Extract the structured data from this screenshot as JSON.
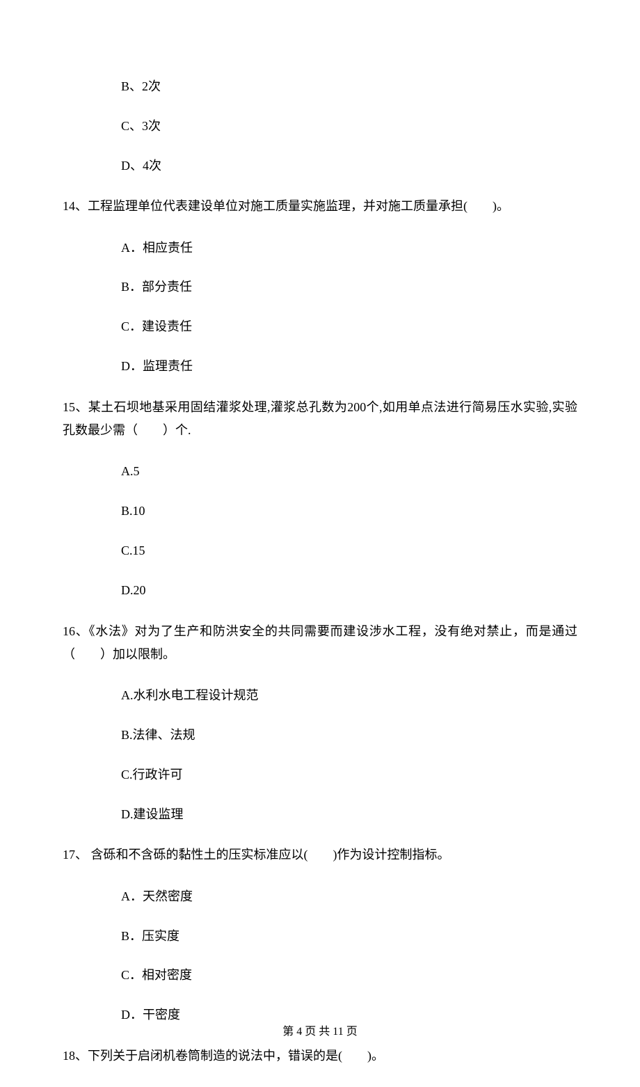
{
  "q13_options": {
    "b": "B、2次",
    "c": "C、3次",
    "d": "D、4次"
  },
  "q14": {
    "text": "14、工程监理单位代表建设单位对施工质量实施监理，并对施工质量承担(　　)。",
    "a": "A．相应责任",
    "b": "B．部分责任",
    "c": "C．建设责任",
    "d": "D．监理责任"
  },
  "q15": {
    "text": "15、某土石坝地基采用固结灌浆处理,灌浆总孔数为200个,如用单点法进行简易压水实验,实验孔数最少需（　　）个.",
    "a": "A.5",
    "b": "B.10",
    "c": "C.15",
    "d": "D.20"
  },
  "q16": {
    "text": "16、《水法》对为了生产和防洪安全的共同需要而建设涉水工程，没有绝对禁止，而是通过（　　）加以限制。",
    "a": "A.水利水电工程设计规范",
    "b": "B.法律、法规",
    "c": "C.行政许可",
    "d": "D.建设监理"
  },
  "q17": {
    "text": "17、 含砾和不含砾的黏性土的压实标准应以(　　)作为设计控制指标。",
    "a": "A．天然密度",
    "b": "B．压实度",
    "c": "C．相对密度",
    "d": "D．干密度"
  },
  "q18": {
    "text": "18、下列关于启闭机卷筒制造的说法中，错误的是(　　)。"
  },
  "footer": "第 4 页 共 11 页"
}
